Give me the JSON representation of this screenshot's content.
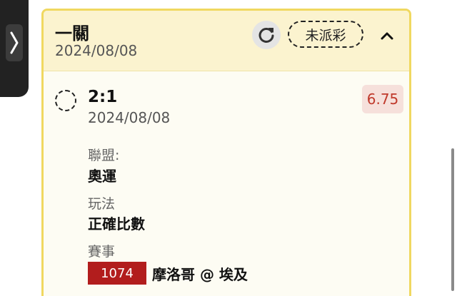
{
  "bet": {
    "title": "一關",
    "date": "2024/08/08",
    "status": "未派彩"
  },
  "selection": {
    "score": "2:1",
    "date": "2024/08/08",
    "odds": "6.75",
    "league_label": "聯盟:",
    "league_value": "奧運",
    "market_label": "玩法",
    "market_value": "正確比數",
    "event_label": "賽事",
    "event_code": "1074",
    "event_name": "摩洛哥 @ 埃及"
  },
  "icons": {
    "side_toggle": "chevron-right-icon",
    "refresh": "refresh-icon",
    "collapse": "chevron-up-icon"
  },
  "colors": {
    "header_bg": "#fbf3cf",
    "card_border": "#f0d860",
    "odds_text": "#c0392b",
    "event_code_bg": "#b21d1d"
  }
}
